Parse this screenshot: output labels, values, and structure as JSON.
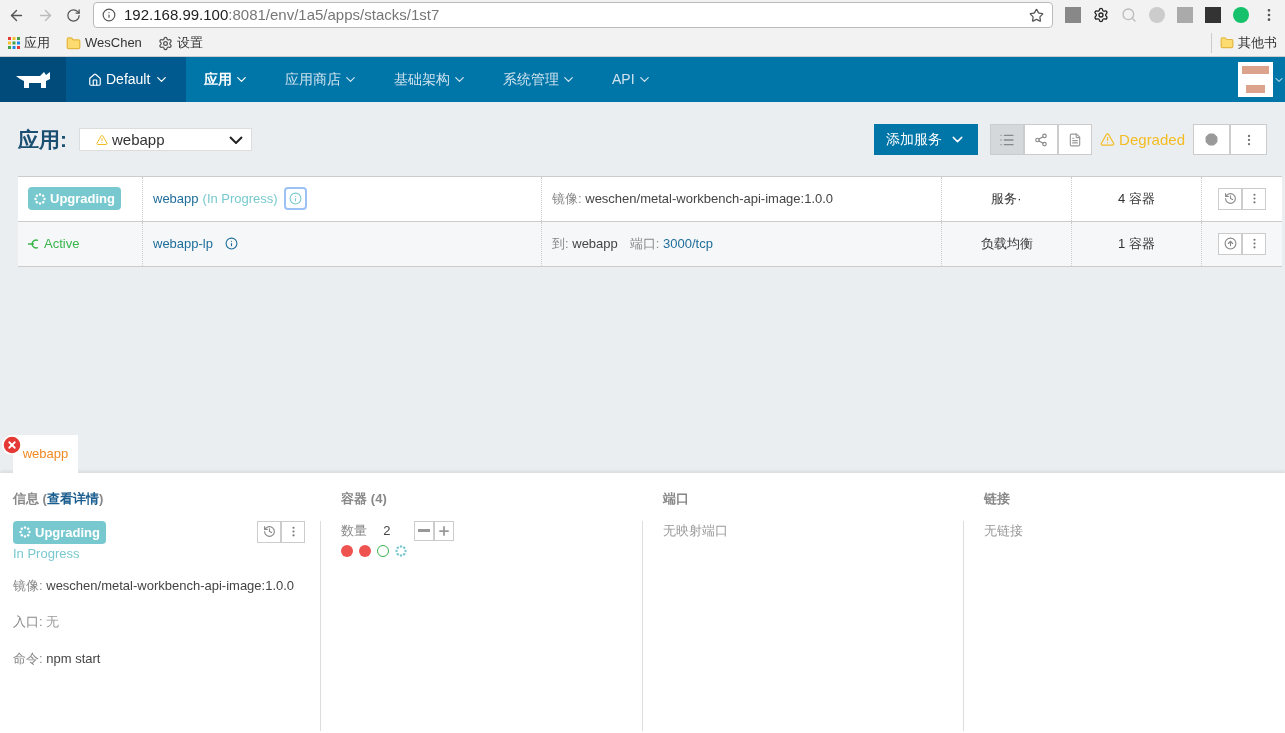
{
  "browser": {
    "url_host": "192.168.99.100",
    "url_rest": ":8081/env/1a5/apps/stacks/1st7",
    "bookmarks": [
      {
        "kind": "apps",
        "label": "应用"
      },
      {
        "kind": "folder",
        "label": "WesChen"
      },
      {
        "kind": "gear",
        "label": "设置"
      }
    ],
    "other_bookmarks": "其他书"
  },
  "nav": {
    "environment": "Default",
    "items": [
      {
        "label": "应用",
        "selected": true
      },
      {
        "label": "应用商店",
        "selected": false
      },
      {
        "label": "基础架构",
        "selected": false
      },
      {
        "label": "系统管理",
        "selected": false
      },
      {
        "label": "API",
        "selected": false
      }
    ]
  },
  "stack": {
    "title": "应用:",
    "selector": "webapp",
    "add_button": "添加服务",
    "views": [
      {
        "kind": "list",
        "selected": true
      },
      {
        "kind": "graph",
        "selected": false
      },
      {
        "kind": "file",
        "selected": false
      }
    ],
    "health": "Degraded"
  },
  "services": [
    {
      "kind": "upgrading",
      "state": "Upgrading",
      "name": "webapp",
      "note": "(In Progress)",
      "info_focused": true,
      "details": [
        {
          "label": "镜像:",
          "value": "weschen/metal-workbench-api-image:1.0.0",
          "link": false
        }
      ],
      "type": "服务·",
      "scale": "4 容器",
      "actions": [
        {
          "kind": "history"
        },
        {
          "kind": "more"
        }
      ]
    },
    {
      "kind": "active",
      "state": "Active",
      "name": "webapp-lp",
      "info_focused": false,
      "details": [
        {
          "label": "到:",
          "value": "webapp",
          "link": false
        },
        {
          "label": "端口:",
          "value": "3000/tcp",
          "link": true
        }
      ],
      "type": "负载均衡",
      "scale": "1 容器",
      "actions": [
        {
          "kind": "upgrade"
        },
        {
          "kind": "more"
        }
      ]
    }
  ],
  "panel": {
    "tab": "webapp",
    "info": {
      "title_prefix": "信息 (",
      "title_link": "查看详情",
      "title_suffix": ")",
      "state": "Upgrading",
      "sub_state": "In Progress",
      "fields": [
        {
          "label": "镜像:",
          "value": "weschen/metal-workbench-api-image:1.0.0",
          "muted": false
        },
        {
          "label": "入口:",
          "value": "无",
          "muted": true
        },
        {
          "label": "命令:",
          "value": "npm start",
          "muted": false
        }
      ]
    },
    "containers": {
      "title": "容器 (4)",
      "scale_label": "数量",
      "scale": "2",
      "instances": [
        {
          "kind": "error"
        },
        {
          "kind": "error"
        },
        {
          "kind": "running"
        },
        {
          "kind": "transitioning"
        }
      ]
    },
    "ports": {
      "title": "端口",
      "empty": "无映射端口"
    },
    "links": {
      "title": "链接",
      "empty": "无链接"
    }
  }
}
